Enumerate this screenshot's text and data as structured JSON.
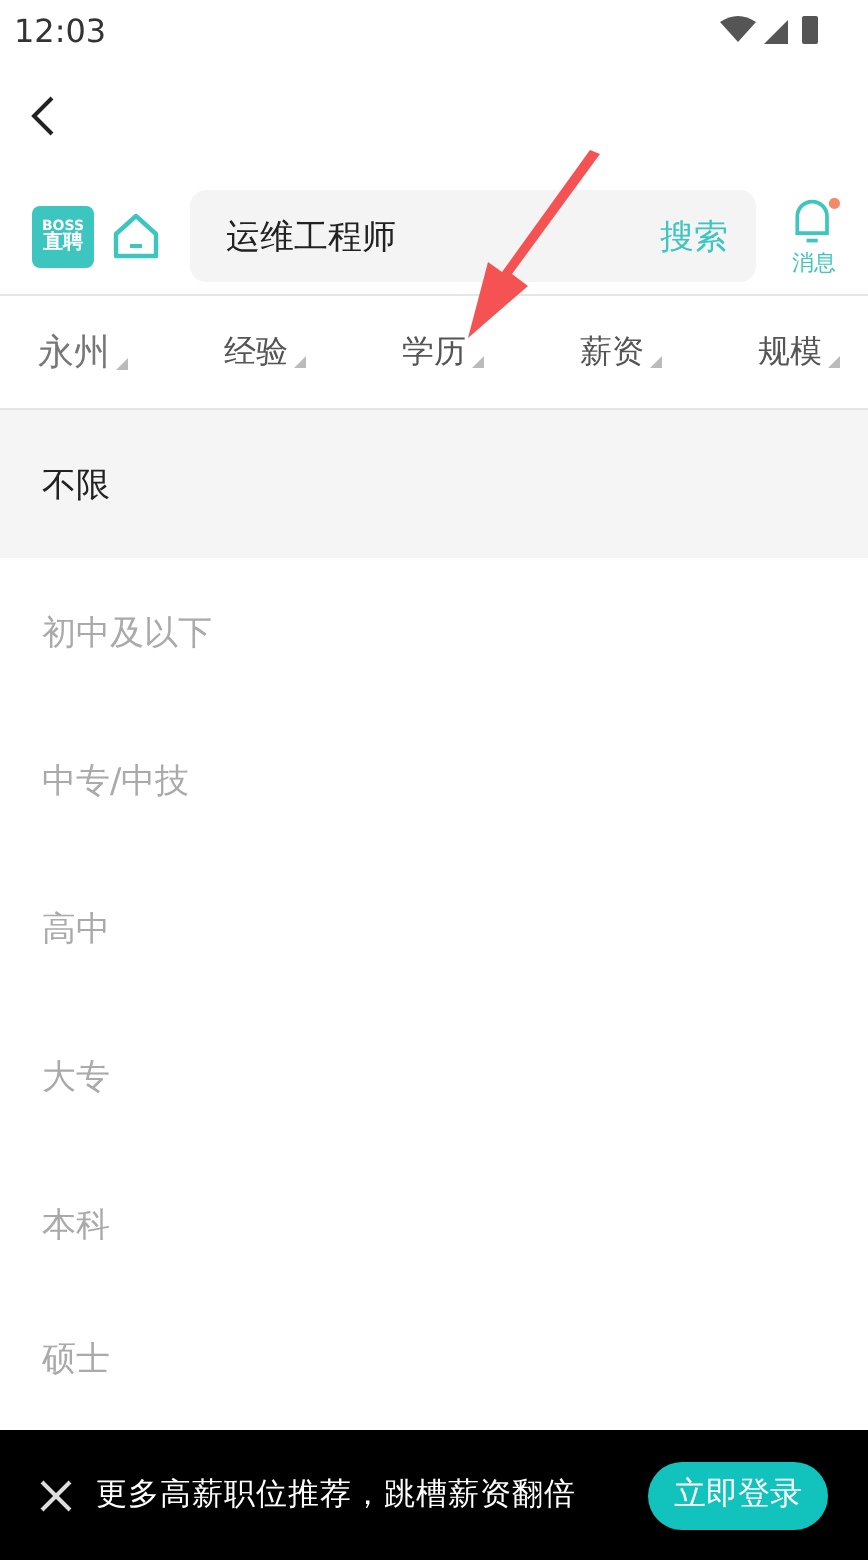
{
  "status_bar": {
    "time": "12:03"
  },
  "header": {
    "logo": {
      "line_1": "BOSS",
      "line_2": "直聘"
    },
    "search": {
      "value": "运维工程师",
      "button": "搜索"
    },
    "messages": {
      "label": "消息",
      "unread": true
    }
  },
  "filters": [
    {
      "label": "永州"
    },
    {
      "label": "经验"
    },
    {
      "label": "学历"
    },
    {
      "label": "薪资"
    },
    {
      "label": "规模"
    }
  ],
  "options": [
    {
      "label": "不限",
      "selected": true
    },
    {
      "label": "初中及以下",
      "selected": false
    },
    {
      "label": "中专/中技",
      "selected": false
    },
    {
      "label": "高中",
      "selected": false
    },
    {
      "label": "大专",
      "selected": false
    },
    {
      "label": "本科",
      "selected": false
    },
    {
      "label": "硕士",
      "selected": false
    }
  ],
  "banner": {
    "text": "更多高薪职位推荐，跳槽薪资翻倍",
    "button": "立即登录"
  }
}
